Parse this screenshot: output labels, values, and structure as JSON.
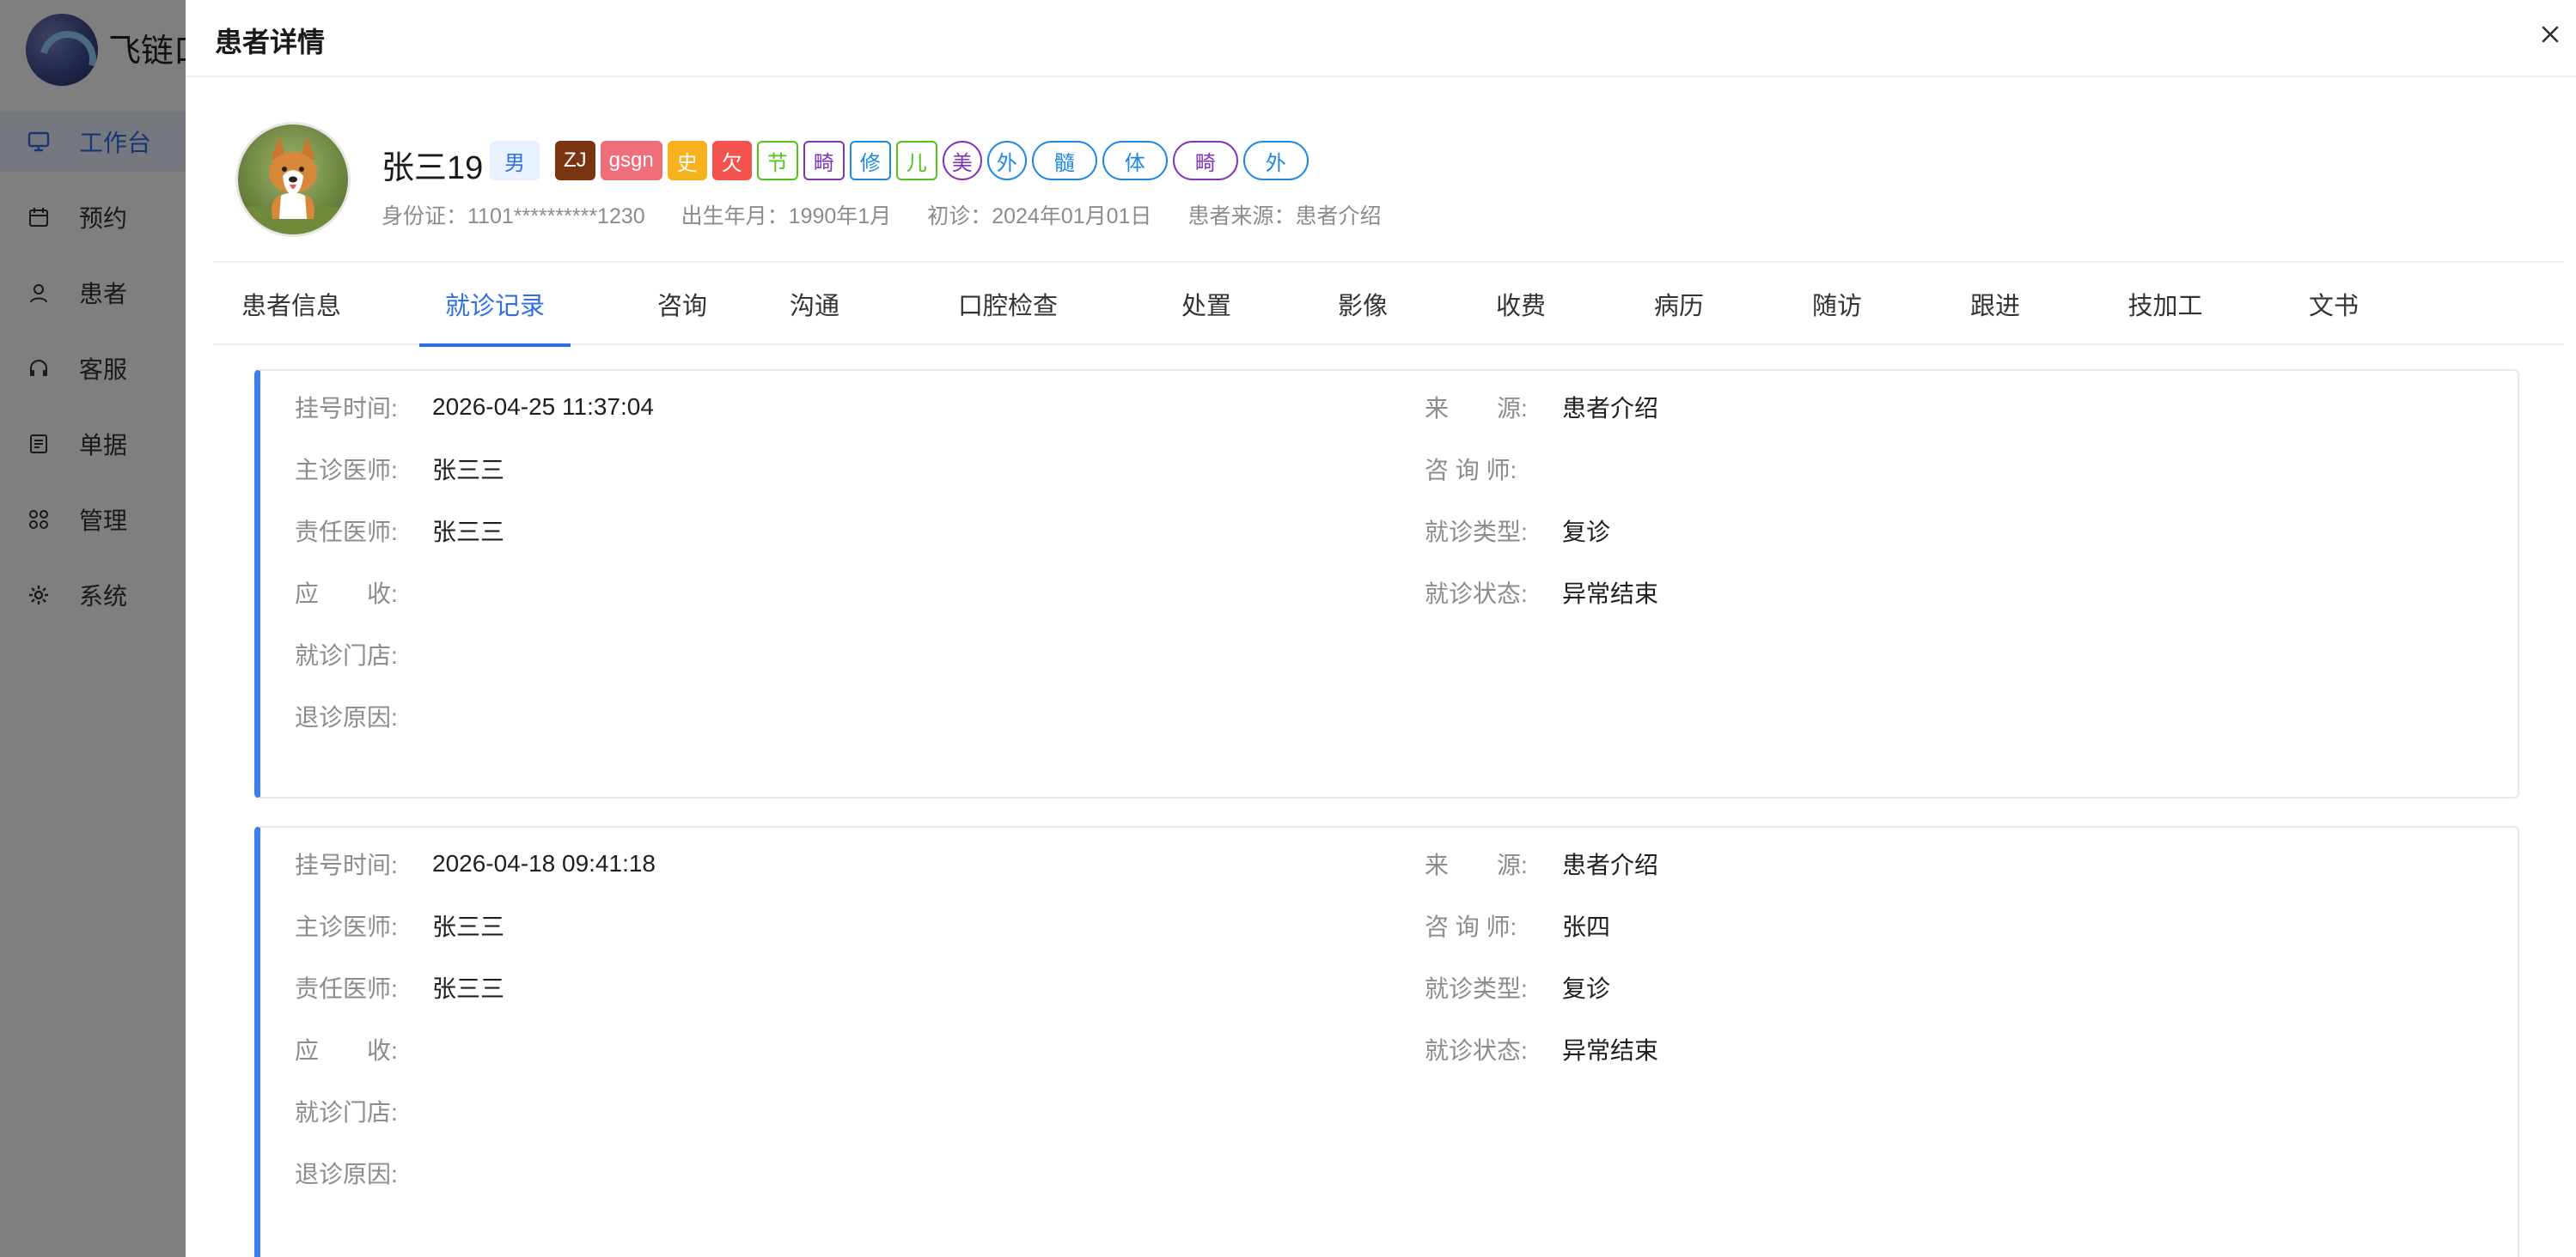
{
  "app": {
    "name": "飞链口",
    "nav": [
      {
        "label": "工作台",
        "icon": "monitor-icon",
        "active": true
      },
      {
        "label": "预约",
        "icon": "calendar-icon"
      },
      {
        "label": "患者",
        "icon": "user-icon"
      },
      {
        "label": "客服",
        "icon": "headset-icon"
      },
      {
        "label": "单据",
        "icon": "receipt-icon"
      },
      {
        "label": "管理",
        "icon": "grid-icon"
      },
      {
        "label": "系统",
        "icon": "gear-icon"
      }
    ]
  },
  "drawer": {
    "title": "患者详情",
    "close_icon": "close-icon"
  },
  "patient": {
    "name": "张三19",
    "gender": "男",
    "tags": [
      {
        "text": "ZJ",
        "style": "solid",
        "color": "#7a3412"
      },
      {
        "text": "gsgn",
        "style": "solid",
        "color": "#f06e7a"
      },
      {
        "text": "史",
        "style": "solid",
        "color": "#f5b21d"
      },
      {
        "text": "欠",
        "style": "solid",
        "color": "#f4524d"
      },
      {
        "text": "节",
        "style": "outline",
        "color": "#52c41a"
      },
      {
        "text": "畸",
        "style": "outline",
        "color": "#7f35b8"
      },
      {
        "text": "修",
        "style": "outline",
        "color": "#1e88e5"
      },
      {
        "text": "儿",
        "style": "outline",
        "color": "#52c41a"
      },
      {
        "text": "美",
        "style": "circle",
        "color": "#7f35b8"
      },
      {
        "text": "外",
        "style": "circle",
        "color": "#1e88e5"
      },
      {
        "text": "髓",
        "style": "circle",
        "color": "#1e88e5"
      },
      {
        "text": "体",
        "style": "circle",
        "color": "#1e88e5"
      },
      {
        "text": "畸",
        "style": "circle",
        "color": "#7f35b8"
      },
      {
        "text": "外",
        "style": "circle",
        "color": "#1e88e5"
      }
    ],
    "meta": {
      "id_card": "身份证：1101**********1230",
      "birth": "出生年月：1990年1月",
      "first_visit": "初诊：2024年01月01日",
      "source": "患者来源：患者介绍"
    }
  },
  "tabs": [
    {
      "label": "患者信息"
    },
    {
      "label": "就诊记录",
      "active": true
    },
    {
      "label": "咨询"
    },
    {
      "label": "沟通"
    },
    {
      "label": "口腔检查"
    },
    {
      "label": "处置"
    },
    {
      "label": "影像"
    },
    {
      "label": "收费"
    },
    {
      "label": "病历"
    },
    {
      "label": "随访"
    },
    {
      "label": "跟进"
    },
    {
      "label": "技加工"
    },
    {
      "label": "文书"
    }
  ],
  "visits": [
    {
      "left": [
        {
          "label": "挂号时间:",
          "value": "2026-04-25 11:37:04"
        },
        {
          "label": "主诊医师:",
          "value": "张三三"
        },
        {
          "label": "责任医师:",
          "value": "张三三"
        },
        {
          "label": "应　　收:",
          "value": ""
        },
        {
          "label": "就诊门店:",
          "value": ""
        },
        {
          "label": "退诊原因:",
          "value": ""
        }
      ],
      "right": [
        {
          "label": "来　　源:",
          "value": "患者介绍"
        },
        {
          "label": "咨 询 师:",
          "value": ""
        },
        {
          "label": "就诊类型:",
          "value": "复诊"
        },
        {
          "label": "就诊状态:",
          "value": "异常结束"
        }
      ]
    },
    {
      "left": [
        {
          "label": "挂号时间:",
          "value": "2026-04-18 09:41:18"
        },
        {
          "label": "主诊医师:",
          "value": "张三三"
        },
        {
          "label": "责任医师:",
          "value": "张三三"
        },
        {
          "label": "应　　收:",
          "value": ""
        },
        {
          "label": "就诊门店:",
          "value": ""
        },
        {
          "label": "退诊原因:",
          "value": ""
        }
      ],
      "right": [
        {
          "label": "来　　源:",
          "value": "患者介绍"
        },
        {
          "label": "咨 询 师:",
          "value": "张四"
        },
        {
          "label": "就诊类型:",
          "value": "复诊"
        },
        {
          "label": "就诊状态:",
          "value": "异常结束"
        }
      ]
    }
  ]
}
